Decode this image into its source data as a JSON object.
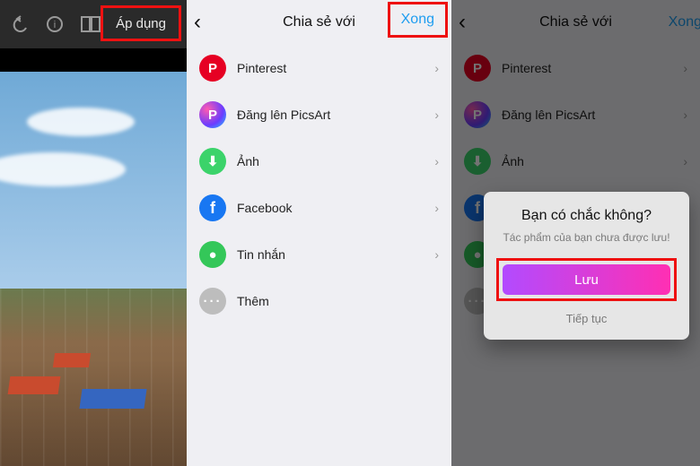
{
  "panel1": {
    "apply_label": "Áp dụng"
  },
  "share": {
    "title": "Chia sẻ với",
    "back": "‹",
    "done": "Xong",
    "items": [
      {
        "label": "Pinterest",
        "icon": "P",
        "cls": "ic-pin"
      },
      {
        "label": "Đăng lên PicsArt",
        "icon": "P",
        "cls": "ic-pic"
      },
      {
        "label": "Ảnh",
        "icon": "⬇",
        "cls": "ic-img"
      },
      {
        "label": "Facebook",
        "icon": "f",
        "cls": "ic-fb"
      },
      {
        "label": "Tin nhắn",
        "icon": "●",
        "cls": "ic-msg"
      },
      {
        "label": "Thêm",
        "icon": "···",
        "cls": "ic-more"
      }
    ]
  },
  "dialog": {
    "title": "Bạn có chắc không?",
    "subtitle": "Tác phẩm của bạn chưa được lưu!",
    "save": "Lưu",
    "continue": "Tiếp tục"
  }
}
